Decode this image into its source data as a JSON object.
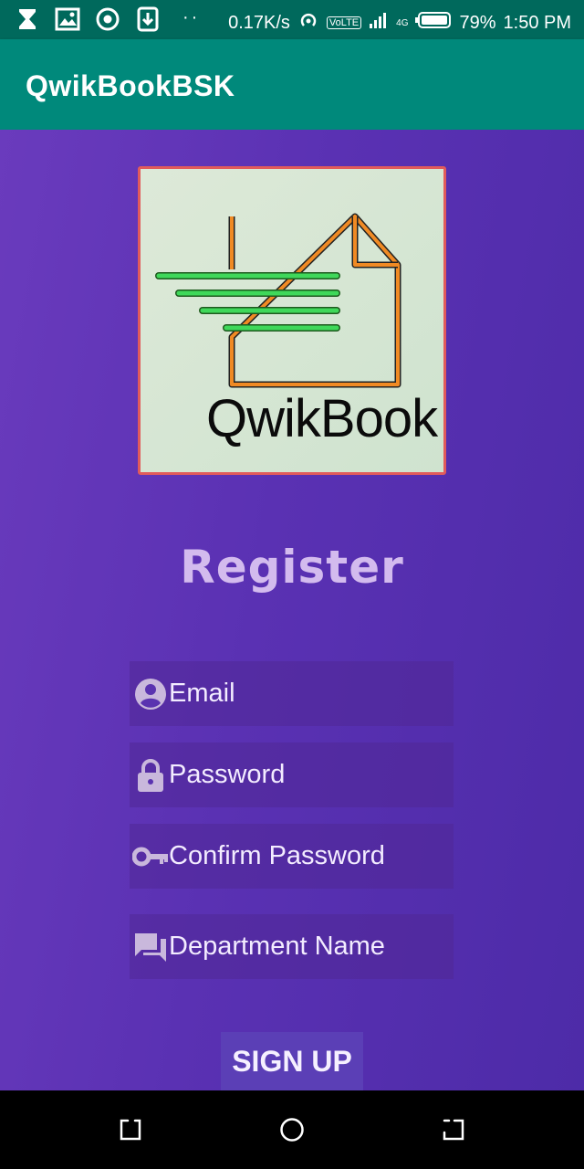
{
  "status_bar": {
    "speed": "0.17K/s",
    "volte": "VoLTE",
    "network": "4G",
    "battery": "79%",
    "time": "1:50 PM",
    "dots": "··"
  },
  "app_bar": {
    "title": "QwikBookBSK"
  },
  "logo": {
    "text": "QwikBook"
  },
  "form": {
    "heading": "Register",
    "email_placeholder": "Email",
    "password_placeholder": "Password",
    "confirm_placeholder": "Confirm Password",
    "department_placeholder": "Department Name",
    "signup_label": "SIGN UP"
  },
  "colors": {
    "status_bar": "#00695c",
    "app_bar": "#00897b",
    "background": "#5a33b0",
    "heading": "#d3bbee"
  }
}
